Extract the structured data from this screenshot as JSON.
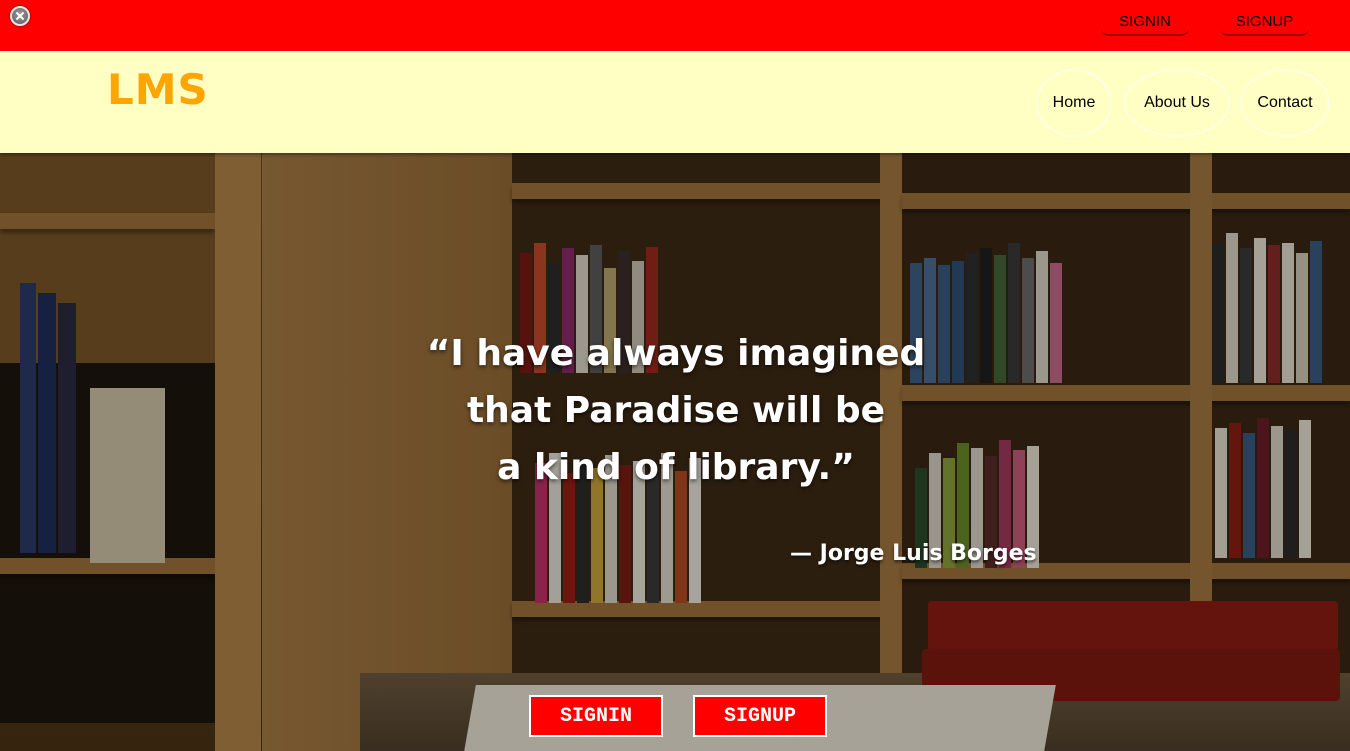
{
  "topbar": {
    "signin_label": "SIGNIN",
    "signup_label": "SIGNUP",
    "background": "#ff0000"
  },
  "header": {
    "logo": "LMS",
    "logo_color": "#ffa500",
    "background": "#ffffc3",
    "nav": [
      {
        "label": "Home"
      },
      {
        "label": "About Us"
      },
      {
        "label": "Contact"
      }
    ]
  },
  "hero": {
    "quote_lines": [
      "“I have always imagined",
      "that Paradise will be",
      "a kind of library.”"
    ],
    "author": "— Jorge Luis Borges",
    "buttons": {
      "signin_label": "SIGNIN",
      "signup_label": "SIGNUP"
    }
  }
}
